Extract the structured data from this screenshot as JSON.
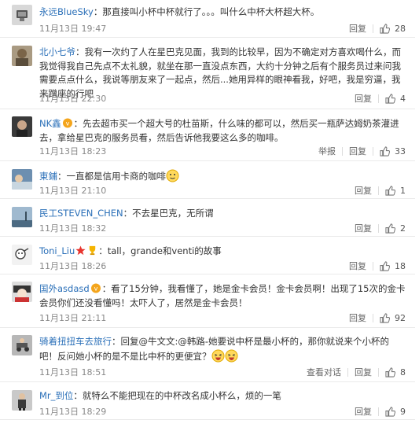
{
  "labels": {
    "reply": "回复",
    "view_dialog": "查看对话",
    "report": "举报"
  },
  "colors": {
    "name": "#2a6fb8",
    "meta": "#888888",
    "separator": "#eaeaea"
  },
  "comments": [
    {
      "user": "永远BlueSky",
      "text": "：那直接叫小杯中杯就行了。。。叫什么中杯大杯超大杯。",
      "time": "11月13日 19:47",
      "likes": "28",
      "actions": [
        "reply"
      ]
    },
    {
      "user": "北小七爷",
      "text": "：我有一次约了人在星巴克见面，我到的比较早，因为不确定对方喜欢喝什么，而我觉得我自己先点不太礼貌，就坐在那一直没点东西，大约十分钟之后有个服务员过来问我需要点点什么，我说等朋友来了一起点，然后...她用异样的眼神看我，好吧，我是穷逼，我来蹭座的行吧",
      "time": "11月13日 22:30",
      "likes": "4",
      "actions": [
        "reply"
      ]
    },
    {
      "user": "NK鑫",
      "text": "：先去超市买一个超大号的杜苗斯，什么味的都可以，然后买一瓶萨达姆奶茶灌进去，拿给星巴克的服务员看，然后告诉他我要这么多的咖啡。",
      "time": "11月13日 18:23",
      "likes": "33",
      "actions": [
        "report",
        "reply"
      ]
    },
    {
      "user": "東鋪",
      "text": "：一直都是信用卡商的咖啡",
      "time": "11月13日 21:10",
      "likes": "1",
      "actions": [
        "reply"
      ]
    },
    {
      "user": "民工STEVEN_CHEN",
      "text": "：不去星巴克，无所谓",
      "time": "11月13日 18:32",
      "likes": "2",
      "actions": [
        "reply"
      ]
    },
    {
      "user": "Toni_Liu",
      "text": "：tall，grande和venti的故事",
      "time": "11月13日 18:26",
      "likes": "18",
      "actions": [
        "reply"
      ]
    },
    {
      "user": "国外asdasd",
      "text": "：看了15分钟，我看懂了，她是金卡会员！金卡会员啊！出现了15次的金卡会员你们还没看懂吗！太吓人了，居然是金卡会员！",
      "time": "11月13日 21:11",
      "likes": "92",
      "actions": [
        "reply"
      ]
    },
    {
      "user": "骑着扭扭车去旅行",
      "text": "：回复@牛文文:@韩路-她要说中杯是最小杯的，那你就说来个小杯的吧！反问她小杯的是不是比中杯的更便宜？",
      "time": "11月13日 18:51",
      "likes": "8",
      "actions": [
        "view_dialog",
        "reply"
      ]
    },
    {
      "user": "Mr_到位",
      "text": "：就特么不能把现在的中杯改名成小杯么，烦的一笔",
      "time": "11月13日 18:29",
      "likes": "9",
      "actions": [
        "reply"
      ]
    }
  ]
}
